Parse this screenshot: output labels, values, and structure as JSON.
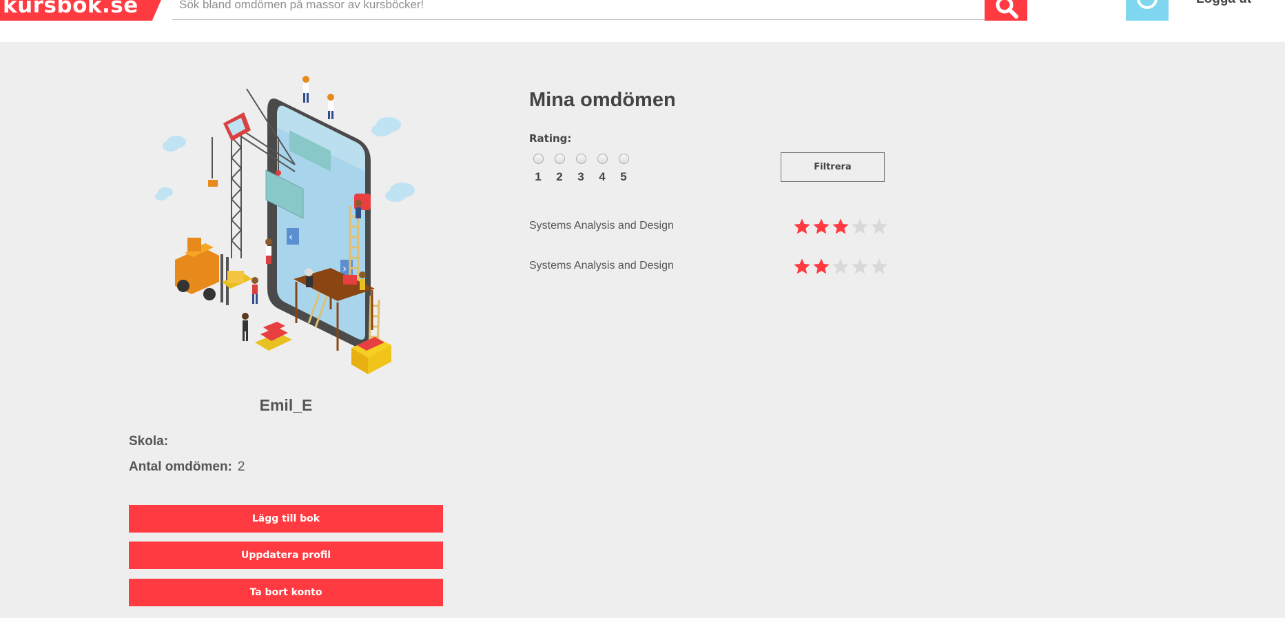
{
  "header": {
    "logo_text": "kursbok.se",
    "search_placeholder": "Sök bland omdömen på massor av kursböcker!",
    "logout_label": "Logga ut",
    "icons": {
      "search": "search-icon",
      "avatar": "user-avatar-icon"
    }
  },
  "profile": {
    "username": "Emil_E",
    "school_label": "Skola:",
    "school_value": "",
    "reviews_count_label": "Antal omdömen:",
    "reviews_count_value": "2",
    "buttons": {
      "add_book": "Lägg till bok",
      "update_profile": "Uppdatera profil",
      "delete_account": "Ta bort konto"
    }
  },
  "reviews": {
    "title": "Mina omdömen",
    "rating_label": "Rating:",
    "rating_options": [
      "1",
      "2",
      "3",
      "4",
      "5"
    ],
    "filter_label": "Filtrera",
    "items": [
      {
        "title": "Systems Analysis and Design",
        "stars": 3,
        "max_stars": 5
      },
      {
        "title": "Systems Analysis and Design",
        "stars": 2,
        "max_stars": 5
      }
    ]
  },
  "colors": {
    "brand_red": "#ff3a40",
    "star_filled": "#ff3a40",
    "star_empty": "#d9d9d9",
    "background": "#eeeeee",
    "avatar_bg": "#7fd6ef"
  }
}
